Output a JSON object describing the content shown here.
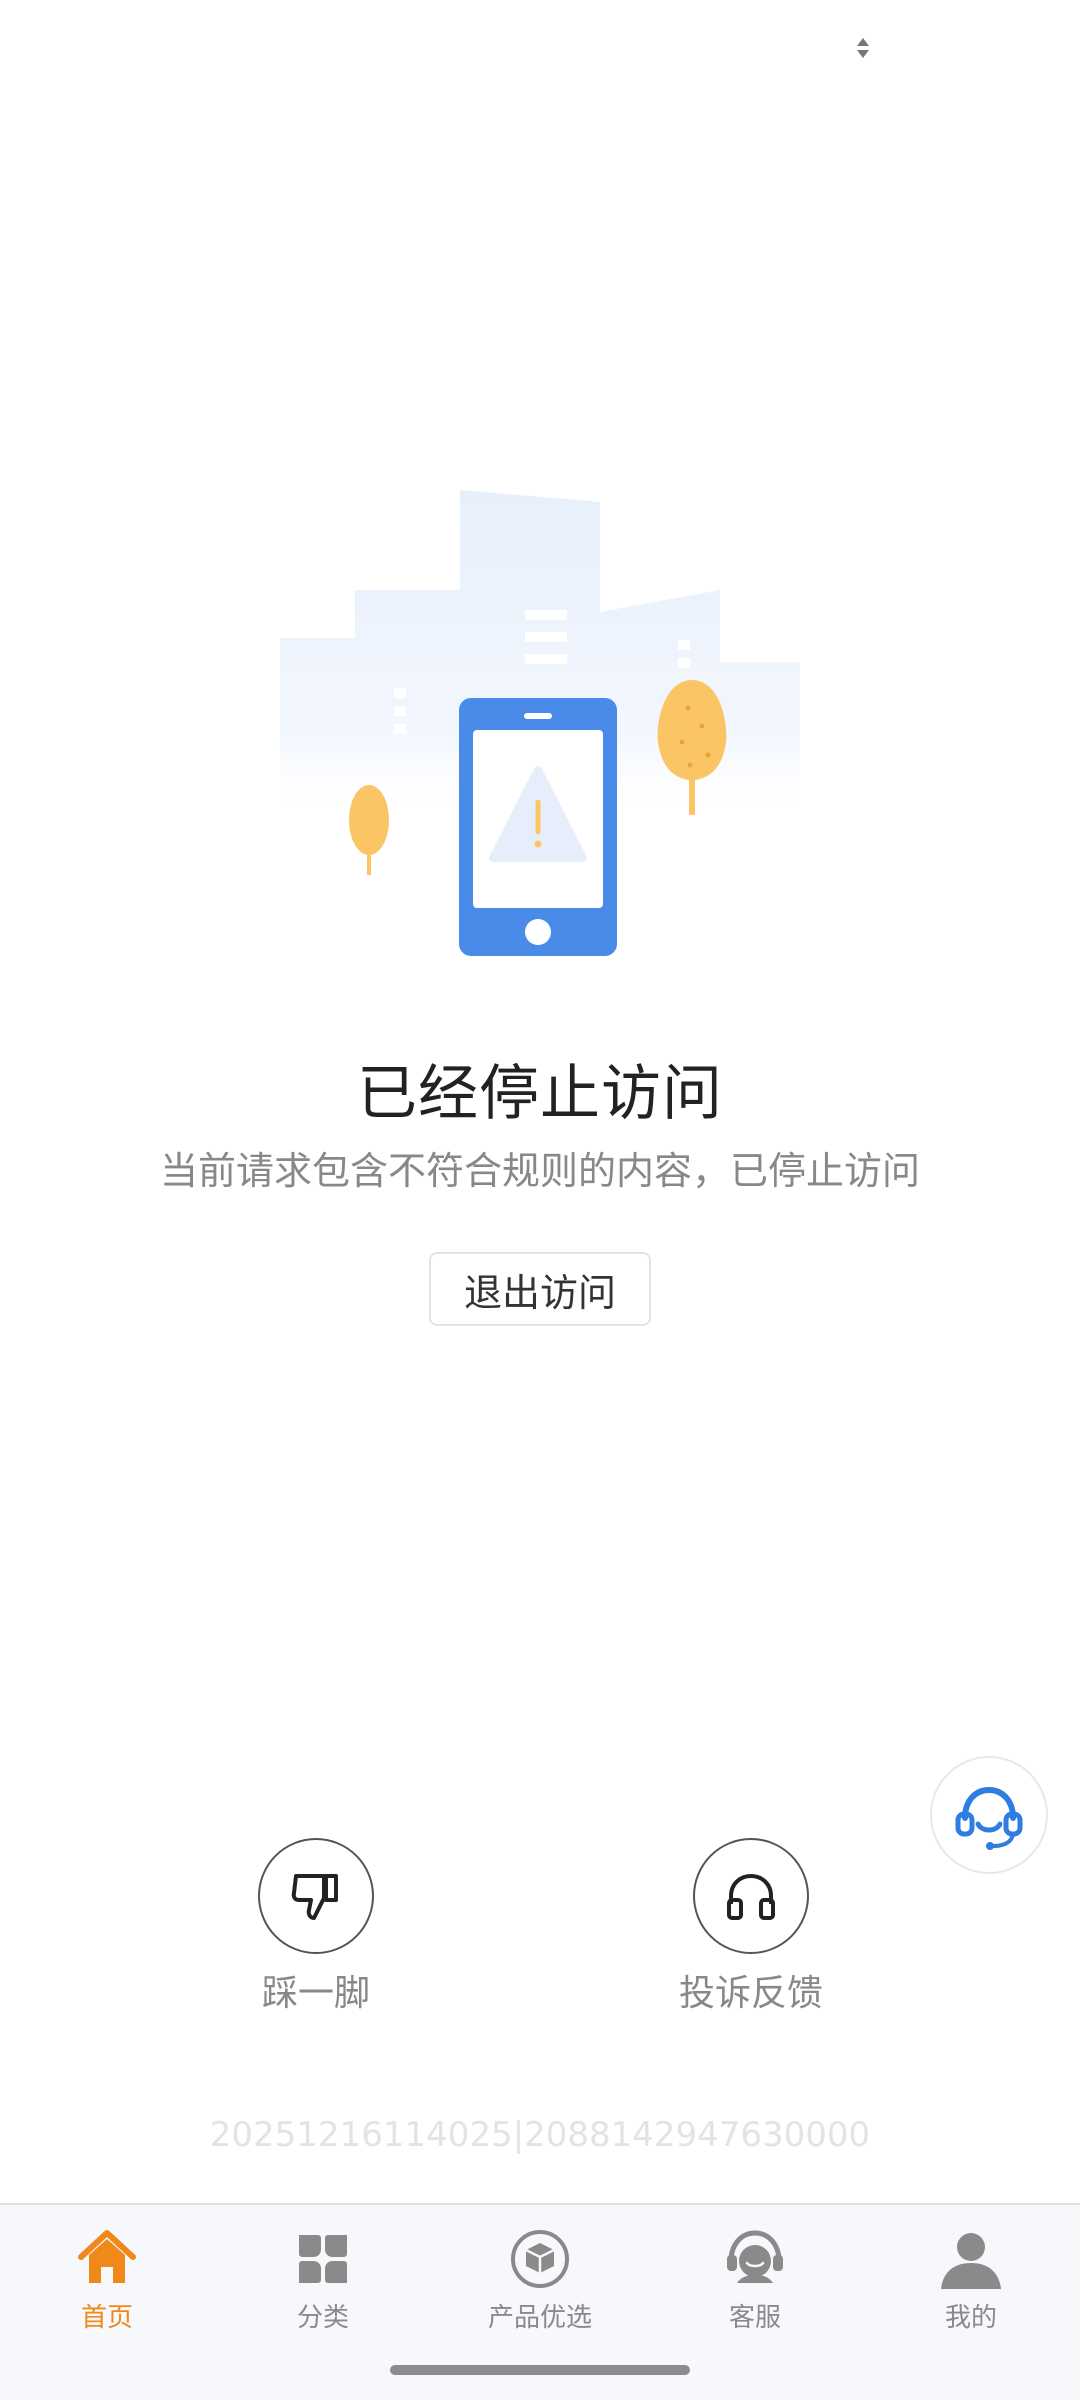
{
  "error": {
    "title": "已经停止访问",
    "message": "当前请求包含不符合规则的内容，已停止访问",
    "exit_label": "退出访问"
  },
  "actions": {
    "dislike_label": "踩一脚",
    "complaint_label": "投诉反馈"
  },
  "trace_id": "20251216114025|2088142947630000",
  "tabbar": {
    "items": [
      {
        "label": "首页",
        "icon": "home-icon",
        "active": true
      },
      {
        "label": "分类",
        "icon": "category-icon",
        "active": false
      },
      {
        "label": "产品优选",
        "icon": "box-icon",
        "active": false
      },
      {
        "label": "客服",
        "icon": "customer-service-icon",
        "active": false
      },
      {
        "label": "我的",
        "icon": "user-icon",
        "active": false
      }
    ]
  },
  "colors": {
    "accent": "#f0881a",
    "phone_blue": "#4a8bea",
    "tree_yellow": "#fbc465",
    "tab_inactive": "#8a8a8a"
  }
}
